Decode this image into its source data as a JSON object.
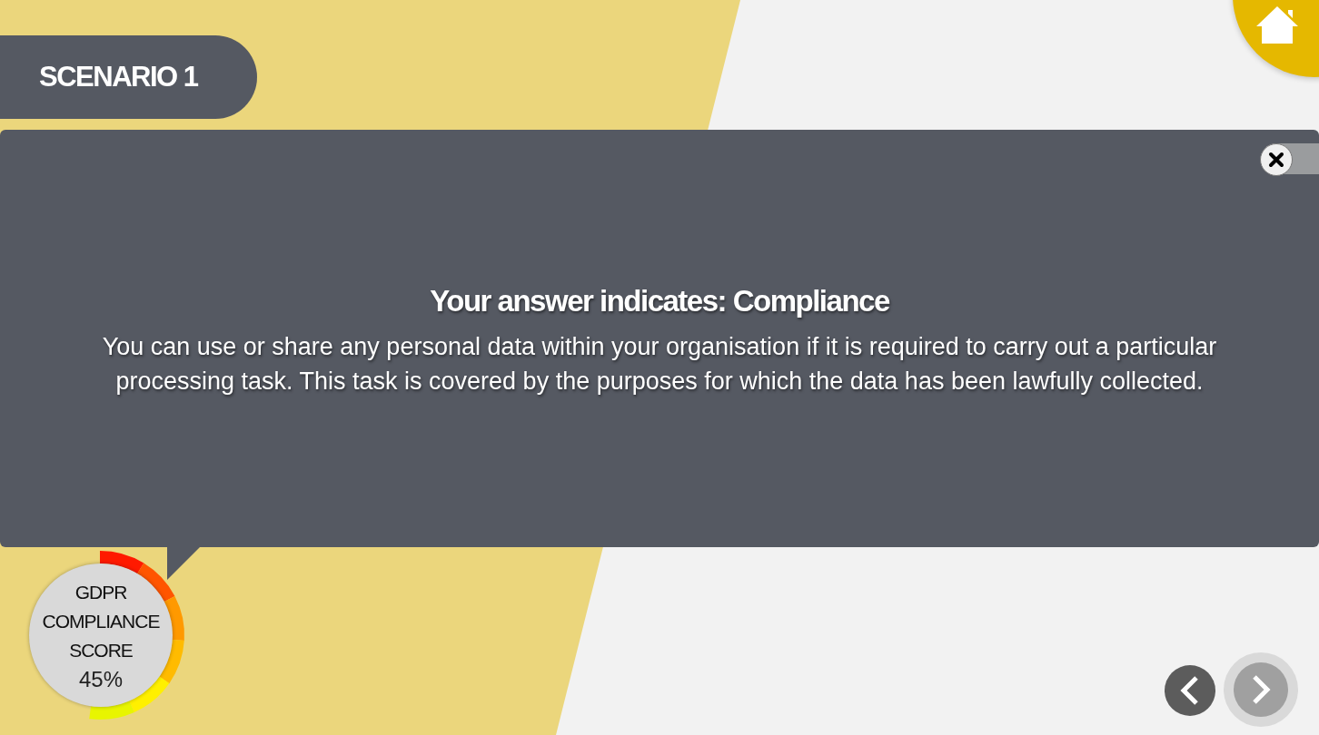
{
  "scenario_label": "SCENARIO 1",
  "feedback": {
    "title": "Your answer indicates: Compliance",
    "body": "You can use or share any personal data within your organisation if it is required to carry out a particular processing task. This task is covered by the purposes for which the data has been lawfully collected."
  },
  "score": {
    "lines": [
      "GDPR",
      "COMPLIANCE",
      "SCORE"
    ],
    "value": "45%"
  },
  "navigation": [
    {
      "kind": "previous",
      "disabled": false
    },
    {
      "kind": "next",
      "disabled": true
    }
  ]
}
